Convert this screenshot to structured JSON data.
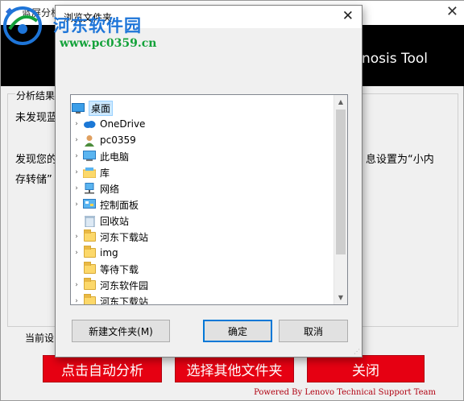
{
  "app": {
    "title": "蓝屏分析",
    "banner_text": "nosis Tool",
    "group_label": "分析结果",
    "result_line1": "未发现蓝",
    "result_line2_left": "发现您的",
    "result_line2_right": "息设置为“小内",
    "result_line3": "存转储”",
    "setting_label": "当前设",
    "buttons": {
      "auto_analyze": "点击自动分析",
      "choose_folder": "选择其他文件夹",
      "close": "关闭"
    },
    "footer": "Powered By Lenovo Technical Support Team"
  },
  "watermark": {
    "name": "河东软件园",
    "url": "www.pc0359.cn"
  },
  "dialog": {
    "title": "浏览文件夹",
    "tree": [
      {
        "label": "桌面",
        "icon": "desktop-icon",
        "arrow": "",
        "selected": true
      },
      {
        "label": "OneDrive",
        "icon": "cloud-icon",
        "arrow": "›"
      },
      {
        "label": "pc0359",
        "icon": "user-icon",
        "arrow": "›"
      },
      {
        "label": "此电脑",
        "icon": "computer-icon",
        "arrow": "›"
      },
      {
        "label": "库",
        "icon": "library-icon",
        "arrow": "›"
      },
      {
        "label": "网络",
        "icon": "network-icon",
        "arrow": "›"
      },
      {
        "label": "控制面板",
        "icon": "control-panel-icon",
        "arrow": "›"
      },
      {
        "label": "回收站",
        "icon": "recycle-bin-icon",
        "arrow": ""
      },
      {
        "label": "河东下载站",
        "icon": "folder-icon",
        "arrow": "›"
      },
      {
        "label": "img",
        "icon": "folder-icon",
        "arrow": "›"
      },
      {
        "label": "等待下载",
        "icon": "folder-icon",
        "arrow": ""
      },
      {
        "label": "河东软件园",
        "icon": "folder-icon",
        "arrow": "›"
      },
      {
        "label": "河东下载站",
        "icon": "folder-icon",
        "arrow": "›"
      }
    ],
    "buttons": {
      "new_folder": "新建文件夹(M)",
      "ok": "确定",
      "cancel": "取消"
    }
  }
}
